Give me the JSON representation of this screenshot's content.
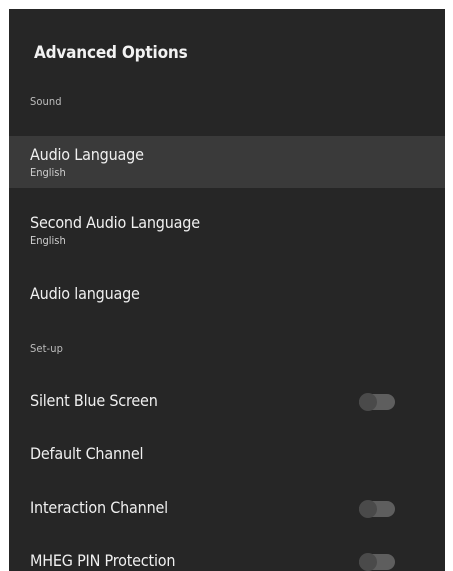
{
  "panel": {
    "title": "Advanced Options"
  },
  "sections": [
    {
      "label": "Sound"
    },
    {
      "label": "Set-up"
    }
  ],
  "items": [
    {
      "label": "Audio Language",
      "value": "English",
      "selected": true
    },
    {
      "label": "Second Audio Language",
      "value": "English"
    },
    {
      "label": "Audio language"
    },
    {
      "label": "Silent Blue Screen",
      "toggle": "off"
    },
    {
      "label": "Default Channel"
    },
    {
      "label": "Interaction Channel",
      "toggle": "off"
    },
    {
      "label": "MHEG PIN Protection",
      "toggle": "off"
    }
  ],
  "colors": {
    "panel_background": "#262626",
    "selected_row": "#3a3a3a",
    "toggle_track": "#5e5e5e",
    "toggle_knob": "#4a4a4a"
  }
}
